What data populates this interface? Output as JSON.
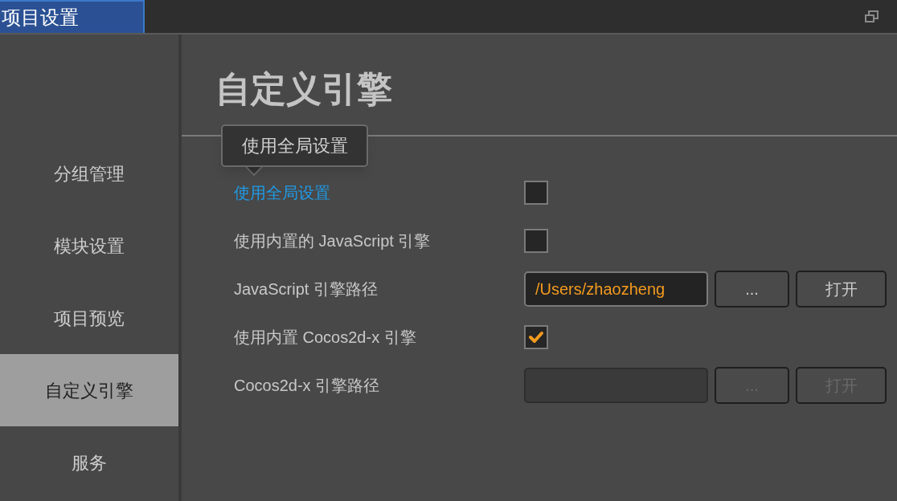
{
  "window": {
    "tab": "项目设置"
  },
  "sidebar": {
    "items": [
      {
        "label": "分组管理",
        "selected": false
      },
      {
        "label": "模块设置",
        "selected": false
      },
      {
        "label": "项目预览",
        "selected": false
      },
      {
        "label": "自定义引擎",
        "selected": true
      },
      {
        "label": "服务",
        "selected": false
      }
    ]
  },
  "page_title": "自定义引擎",
  "tooltip": "使用全局设置",
  "rows": [
    {
      "kind": "checkbox",
      "label": "使用全局设置",
      "hovered": true,
      "checked": false
    },
    {
      "kind": "checkbox",
      "label": "使用内置的 JavaScript 引擎",
      "hovered": false,
      "checked": false
    },
    {
      "kind": "path",
      "label": "JavaScript 引擎路径",
      "hovered": false,
      "value": "/Users/zhaozheng",
      "disabled": false,
      "browse": "...",
      "open": "打开"
    },
    {
      "kind": "checkbox",
      "label": "使用内置 Cocos2d-x 引擎",
      "hovered": false,
      "checked": true
    },
    {
      "kind": "path",
      "label": "Cocos2d-x 引擎路径",
      "hovered": false,
      "value": "",
      "disabled": true,
      "browse": "...",
      "open": "打开"
    }
  ]
}
